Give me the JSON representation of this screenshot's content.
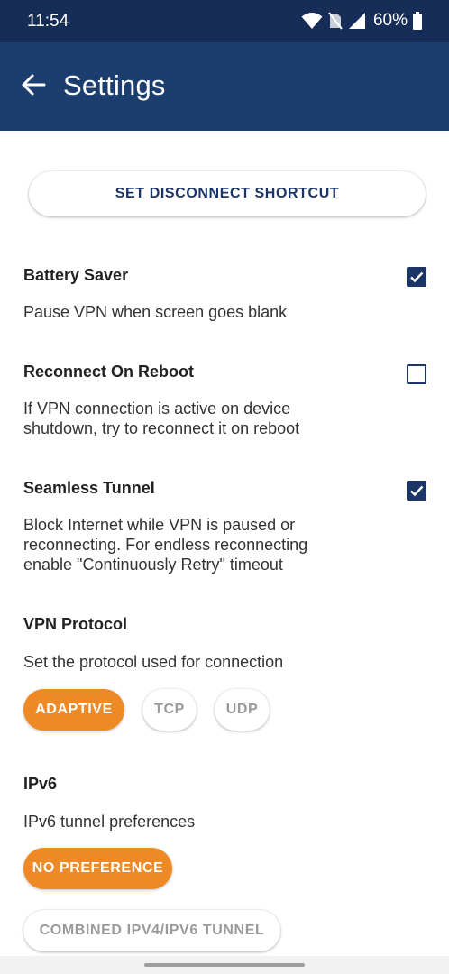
{
  "status_bar": {
    "time": "11:54",
    "battery_percent": "60%"
  },
  "app_bar": {
    "title": "Settings",
    "back_icon": "arrow-left-icon"
  },
  "shortcut_button": {
    "label": "SET DISCONNECT SHORTCUT"
  },
  "settings": {
    "battery_saver": {
      "title": "Battery Saver",
      "description": "Pause VPN when screen goes blank",
      "checked": true
    },
    "reconnect_on_reboot": {
      "title": "Reconnect On Reboot",
      "description": "If VPN connection is active on device shutdown, try to reconnect it on reboot",
      "checked": false
    },
    "seamless_tunnel": {
      "title": "Seamless Tunnel",
      "description": "Block Internet while VPN is paused or reconnecting. For endless reconnecting enable \"Continuously Retry\" timeout",
      "checked": true
    },
    "vpn_protocol": {
      "title": "VPN Protocol",
      "description": "Set the protocol used for connection",
      "options": [
        "ADAPTIVE",
        "TCP",
        "UDP"
      ],
      "selected": "ADAPTIVE"
    },
    "ipv6": {
      "title": "IPv6",
      "description": "IPv6 tunnel preferences",
      "options": [
        "NO PREFERENCE",
        "COMBINED IPV4/IPV6 TUNNEL"
      ],
      "selected": "NO PREFERENCE"
    }
  },
  "colors": {
    "status_bar": "#162d57",
    "app_bar": "#1c3e6f",
    "accent": "#ee8a26",
    "checkbox": "#1b3566"
  }
}
